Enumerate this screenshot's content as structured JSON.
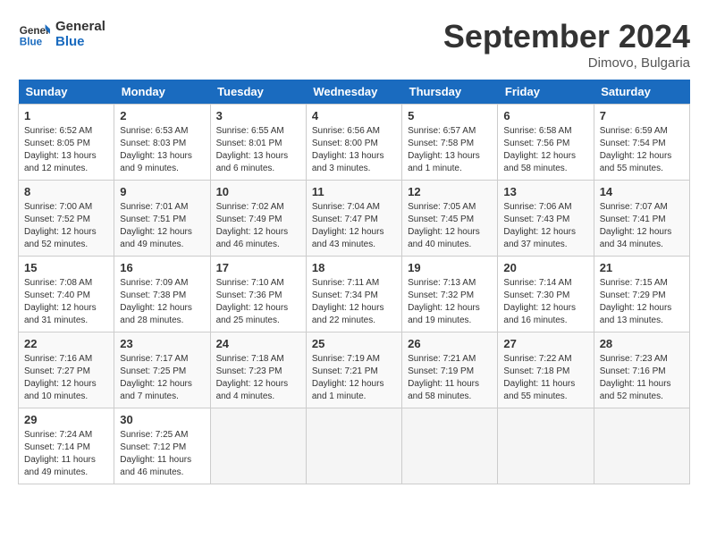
{
  "header": {
    "logo_general": "General",
    "logo_blue": "Blue",
    "month_year": "September 2024",
    "location": "Dimovo, Bulgaria"
  },
  "days_of_week": [
    "Sunday",
    "Monday",
    "Tuesday",
    "Wednesday",
    "Thursday",
    "Friday",
    "Saturday"
  ],
  "weeks": [
    [
      {
        "day": 1,
        "info": "Sunrise: 6:52 AM\nSunset: 8:05 PM\nDaylight: 13 hours\nand 12 minutes."
      },
      {
        "day": 2,
        "info": "Sunrise: 6:53 AM\nSunset: 8:03 PM\nDaylight: 13 hours\nand 9 minutes."
      },
      {
        "day": 3,
        "info": "Sunrise: 6:55 AM\nSunset: 8:01 PM\nDaylight: 13 hours\nand 6 minutes."
      },
      {
        "day": 4,
        "info": "Sunrise: 6:56 AM\nSunset: 8:00 PM\nDaylight: 13 hours\nand 3 minutes."
      },
      {
        "day": 5,
        "info": "Sunrise: 6:57 AM\nSunset: 7:58 PM\nDaylight: 13 hours\nand 1 minute."
      },
      {
        "day": 6,
        "info": "Sunrise: 6:58 AM\nSunset: 7:56 PM\nDaylight: 12 hours\nand 58 minutes."
      },
      {
        "day": 7,
        "info": "Sunrise: 6:59 AM\nSunset: 7:54 PM\nDaylight: 12 hours\nand 55 minutes."
      }
    ],
    [
      {
        "day": 8,
        "info": "Sunrise: 7:00 AM\nSunset: 7:52 PM\nDaylight: 12 hours\nand 52 minutes."
      },
      {
        "day": 9,
        "info": "Sunrise: 7:01 AM\nSunset: 7:51 PM\nDaylight: 12 hours\nand 49 minutes."
      },
      {
        "day": 10,
        "info": "Sunrise: 7:02 AM\nSunset: 7:49 PM\nDaylight: 12 hours\nand 46 minutes."
      },
      {
        "day": 11,
        "info": "Sunrise: 7:04 AM\nSunset: 7:47 PM\nDaylight: 12 hours\nand 43 minutes."
      },
      {
        "day": 12,
        "info": "Sunrise: 7:05 AM\nSunset: 7:45 PM\nDaylight: 12 hours\nand 40 minutes."
      },
      {
        "day": 13,
        "info": "Sunrise: 7:06 AM\nSunset: 7:43 PM\nDaylight: 12 hours\nand 37 minutes."
      },
      {
        "day": 14,
        "info": "Sunrise: 7:07 AM\nSunset: 7:41 PM\nDaylight: 12 hours\nand 34 minutes."
      }
    ],
    [
      {
        "day": 15,
        "info": "Sunrise: 7:08 AM\nSunset: 7:40 PM\nDaylight: 12 hours\nand 31 minutes."
      },
      {
        "day": 16,
        "info": "Sunrise: 7:09 AM\nSunset: 7:38 PM\nDaylight: 12 hours\nand 28 minutes."
      },
      {
        "day": 17,
        "info": "Sunrise: 7:10 AM\nSunset: 7:36 PM\nDaylight: 12 hours\nand 25 minutes."
      },
      {
        "day": 18,
        "info": "Sunrise: 7:11 AM\nSunset: 7:34 PM\nDaylight: 12 hours\nand 22 minutes."
      },
      {
        "day": 19,
        "info": "Sunrise: 7:13 AM\nSunset: 7:32 PM\nDaylight: 12 hours\nand 19 minutes."
      },
      {
        "day": 20,
        "info": "Sunrise: 7:14 AM\nSunset: 7:30 PM\nDaylight: 12 hours\nand 16 minutes."
      },
      {
        "day": 21,
        "info": "Sunrise: 7:15 AM\nSunset: 7:29 PM\nDaylight: 12 hours\nand 13 minutes."
      }
    ],
    [
      {
        "day": 22,
        "info": "Sunrise: 7:16 AM\nSunset: 7:27 PM\nDaylight: 12 hours\nand 10 minutes."
      },
      {
        "day": 23,
        "info": "Sunrise: 7:17 AM\nSunset: 7:25 PM\nDaylight: 12 hours\nand 7 minutes."
      },
      {
        "day": 24,
        "info": "Sunrise: 7:18 AM\nSunset: 7:23 PM\nDaylight: 12 hours\nand 4 minutes."
      },
      {
        "day": 25,
        "info": "Sunrise: 7:19 AM\nSunset: 7:21 PM\nDaylight: 12 hours\nand 1 minute."
      },
      {
        "day": 26,
        "info": "Sunrise: 7:21 AM\nSunset: 7:19 PM\nDaylight: 11 hours\nand 58 minutes."
      },
      {
        "day": 27,
        "info": "Sunrise: 7:22 AM\nSunset: 7:18 PM\nDaylight: 11 hours\nand 55 minutes."
      },
      {
        "day": 28,
        "info": "Sunrise: 7:23 AM\nSunset: 7:16 PM\nDaylight: 11 hours\nand 52 minutes."
      }
    ],
    [
      {
        "day": 29,
        "info": "Sunrise: 7:24 AM\nSunset: 7:14 PM\nDaylight: 11 hours\nand 49 minutes."
      },
      {
        "day": 30,
        "info": "Sunrise: 7:25 AM\nSunset: 7:12 PM\nDaylight: 11 hours\nand 46 minutes."
      },
      null,
      null,
      null,
      null,
      null
    ]
  ]
}
